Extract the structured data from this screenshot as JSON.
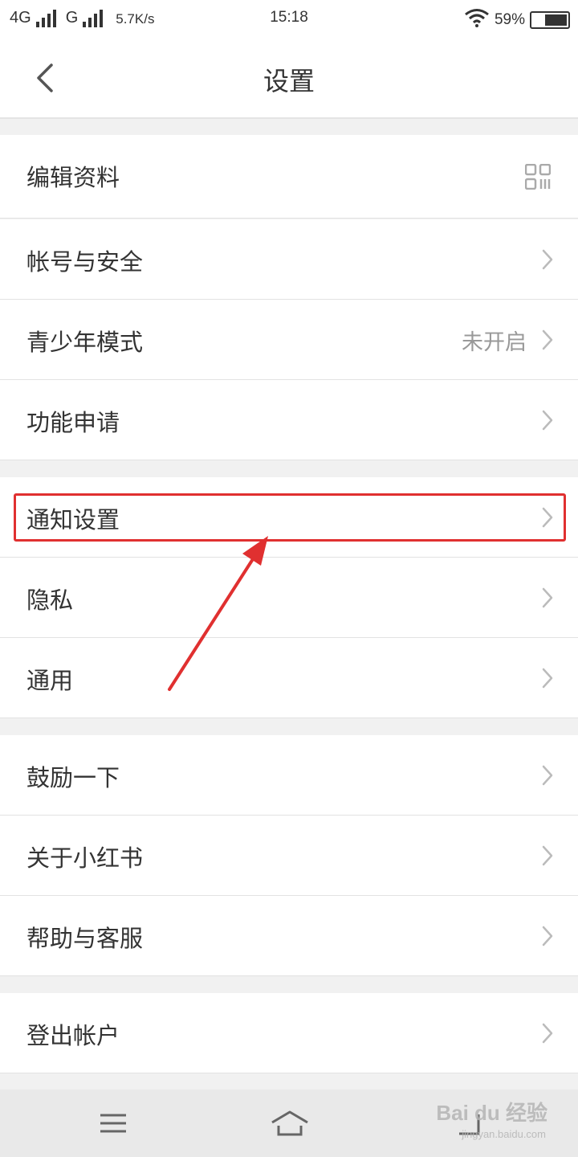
{
  "status_bar": {
    "net1": "4G",
    "net2": "G",
    "speed": "5.7K/s",
    "time": "15:18",
    "battery_text": "59%",
    "battery_level": 0.59,
    "icons": [
      "signal-icon",
      "signal-icon",
      "wifi-icon",
      "battery-icon"
    ]
  },
  "header": {
    "title": "设置",
    "back_icon": "chevron-left-icon"
  },
  "settings": {
    "items": [
      {
        "label": "编辑资料",
        "value": "",
        "icon": "qr-code-icon"
      },
      {
        "label": "帐号与安全",
        "value": "",
        "icon": "chevron-right-icon"
      },
      {
        "label": "青少年模式",
        "value": "未开启",
        "icon": "chevron-right-icon"
      },
      {
        "label": "功能申请",
        "value": "",
        "icon": "chevron-right-icon"
      },
      {
        "label": "通知设置",
        "value": "",
        "icon": "chevron-right-icon"
      },
      {
        "label": "隐私",
        "value": "",
        "icon": "chevron-right-icon"
      },
      {
        "label": "通用",
        "value": "",
        "icon": "chevron-right-icon"
      },
      {
        "label": "鼓励一下",
        "value": "",
        "icon": "chevron-right-icon"
      },
      {
        "label": "关于小红书",
        "value": "",
        "icon": "chevron-right-icon"
      },
      {
        "label": "帮助与客服",
        "value": "",
        "icon": "chevron-right-icon"
      },
      {
        "label": "登出帐户",
        "value": "",
        "icon": "chevron-right-icon"
      }
    ]
  },
  "annotation": {
    "highlight_color": "#e03030"
  },
  "system_nav": {
    "icons": [
      "menu-icon",
      "home-icon",
      "back-icon"
    ]
  },
  "watermark": {
    "main": "Bai du 经验",
    "sub": "jingyan.baidu.com"
  }
}
